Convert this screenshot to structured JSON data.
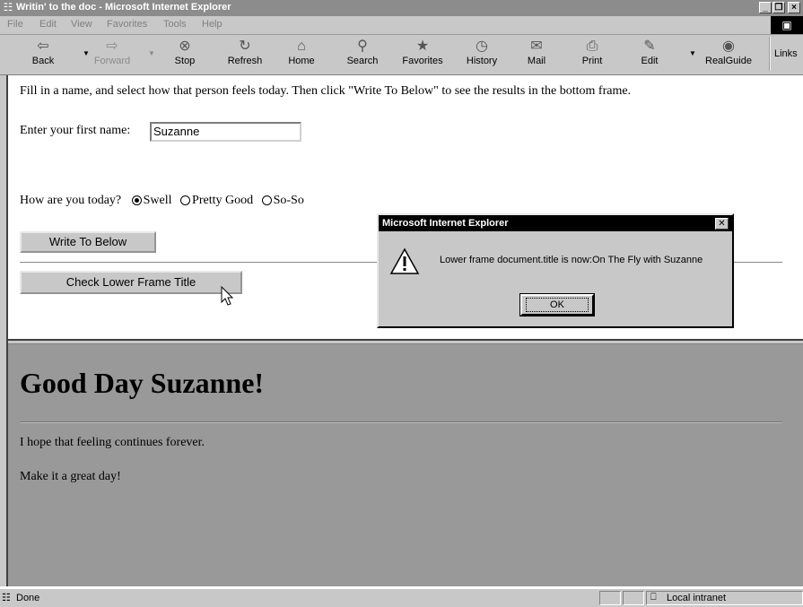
{
  "window": {
    "title": "Writin' to the doc - Microsoft Internet Explorer",
    "controls": [
      "_",
      " ",
      "×"
    ]
  },
  "menubar": {
    "items": [
      "File",
      "Edit",
      "View",
      "Favorites",
      "Tools",
      "Help"
    ]
  },
  "toolbar": {
    "buttons": [
      {
        "label": "Back",
        "icon": "back-arrow-icon",
        "glyph": "⇦"
      },
      {
        "label": "Forward",
        "icon": "forward-arrow-icon",
        "glyph": "⇨"
      },
      {
        "label": "Stop",
        "icon": "stop-icon",
        "glyph": "⊗"
      },
      {
        "label": "Refresh",
        "icon": "refresh-icon",
        "glyph": "↻"
      },
      {
        "label": "Home",
        "icon": "home-icon",
        "glyph": "⌂"
      },
      {
        "label": "Search",
        "icon": "search-icon",
        "glyph": "⚲"
      },
      {
        "label": "Favorites",
        "icon": "favorites-icon",
        "glyph": "★"
      },
      {
        "label": "History",
        "icon": "history-icon",
        "glyph": "◷"
      },
      {
        "label": "Mail",
        "icon": "mail-icon",
        "glyph": "✉"
      },
      {
        "label": "Print",
        "icon": "print-icon",
        "glyph": "⎙"
      },
      {
        "label": "Edit",
        "icon": "edit-icon",
        "glyph": "✎"
      },
      {
        "label": "RealGuide",
        "icon": "realguide-icon",
        "glyph": "◉"
      }
    ],
    "links_label": "Links"
  },
  "top_frame": {
    "instructions": "Fill in a name, and select how that person feels today. Then click \"Write To Below\" to see the results in the bottom frame.",
    "name_label": "Enter your first name:",
    "name_value": "Suzanne",
    "mood_label": "How are you today?",
    "mood_options": [
      "Swell",
      "Pretty Good",
      "So-So"
    ],
    "mood_selected": "Swell",
    "write_button": "Write To Below",
    "check_button": "Check Lower Frame Title"
  },
  "bottom_frame": {
    "heading": "Good Day Suzanne!",
    "line1": "I hope that feeling continues forever.",
    "line2": "Make it a great day!"
  },
  "dialog": {
    "title": "Microsoft Internet Explorer",
    "message": "Lower frame document.title is now:On The Fly with Suzanne",
    "ok_label": "OK",
    "icon": "warning-icon"
  },
  "statusbar": {
    "status": "Done",
    "zone": "Local intranet"
  }
}
